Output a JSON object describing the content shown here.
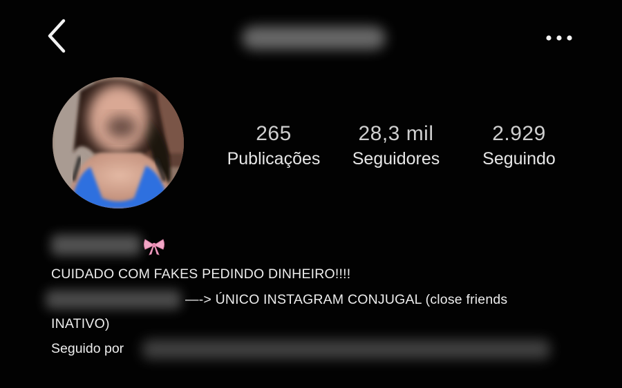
{
  "header": {
    "back_icon": "chevron-left-icon",
    "more_icon": "more-horizontal-icon"
  },
  "profile": {
    "avatar_icon": "profile-avatar",
    "stats": {
      "posts_count": "265",
      "posts_label": "Publicações",
      "followers_count": "28,3 mil",
      "followers_label": "Seguidores",
      "following_count": "2.929",
      "following_label": "Seguindo"
    }
  },
  "bio": {
    "name_emoji": "🎀",
    "line1": "CUIDADO COM FAKES PEDINDO DINHEIRO!!!!",
    "line2": "—-> ÚNICO INSTAGRAM CONJUGAL (close friends",
    "line3": "INATIVO)",
    "followed_by_label": "Seguido por"
  },
  "colors": {
    "background": "#020202",
    "text_primary": "#ededed",
    "text_count": "#cfcfcf",
    "bow_pink": "#f2a6c6"
  }
}
